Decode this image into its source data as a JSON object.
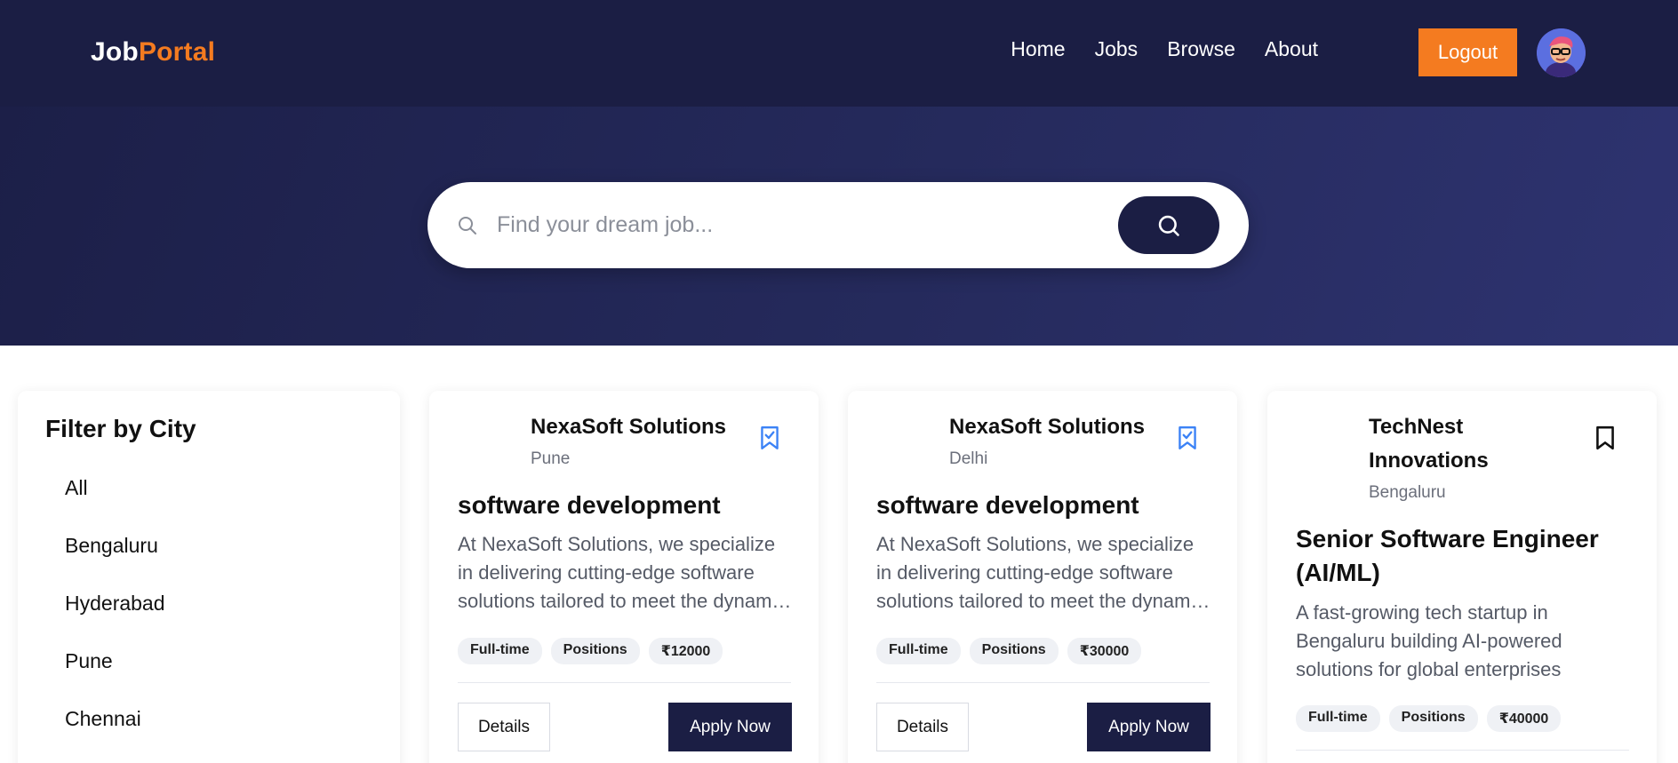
{
  "header": {
    "logo_part1": "Job",
    "logo_part2": "Portal",
    "nav": [
      "Home",
      "Jobs",
      "Browse",
      "About"
    ],
    "logout_label": "Logout",
    "accent_color": "#f47b20",
    "brand_dark": "#1b1e44"
  },
  "search": {
    "placeholder": "Find your dream job...",
    "value": ""
  },
  "sidebar": {
    "title": "Filter by City",
    "cities": [
      "All",
      "Bengaluru",
      "Hyderabad",
      "Pune",
      "Chennai"
    ]
  },
  "jobs": [
    {
      "company": "NexaSoft Solutions",
      "location": "Pune",
      "saved": true,
      "title": "software development",
      "description": "At NexaSoft Solutions, we specialize in delivering cutting-edge software solutions tailored to meet the dynamic needs of businesses",
      "tags": [
        "Full-time",
        "Positions",
        "₹12000"
      ],
      "details_label": "Details",
      "apply_label": "Apply Now"
    },
    {
      "company": "NexaSoft Solutions",
      "location": "Delhi",
      "saved": true,
      "title": "software development",
      "description": "At NexaSoft Solutions, we specialize in delivering cutting-edge software solutions tailored to meet the dynamic needs of businesses",
      "tags": [
        "Full-time",
        "Positions",
        "₹30000"
      ],
      "details_label": "Details",
      "apply_label": "Apply Now"
    },
    {
      "company": "TechNest Innovations",
      "location": "Bengaluru",
      "saved": false,
      "title": "Senior Software Engineer (AI/ML)",
      "description": "A fast-growing tech startup in Bengaluru building AI-powered solutions for global enterprises",
      "tags": [
        "Full-time",
        "Positions",
        "₹40000"
      ]
    }
  ]
}
